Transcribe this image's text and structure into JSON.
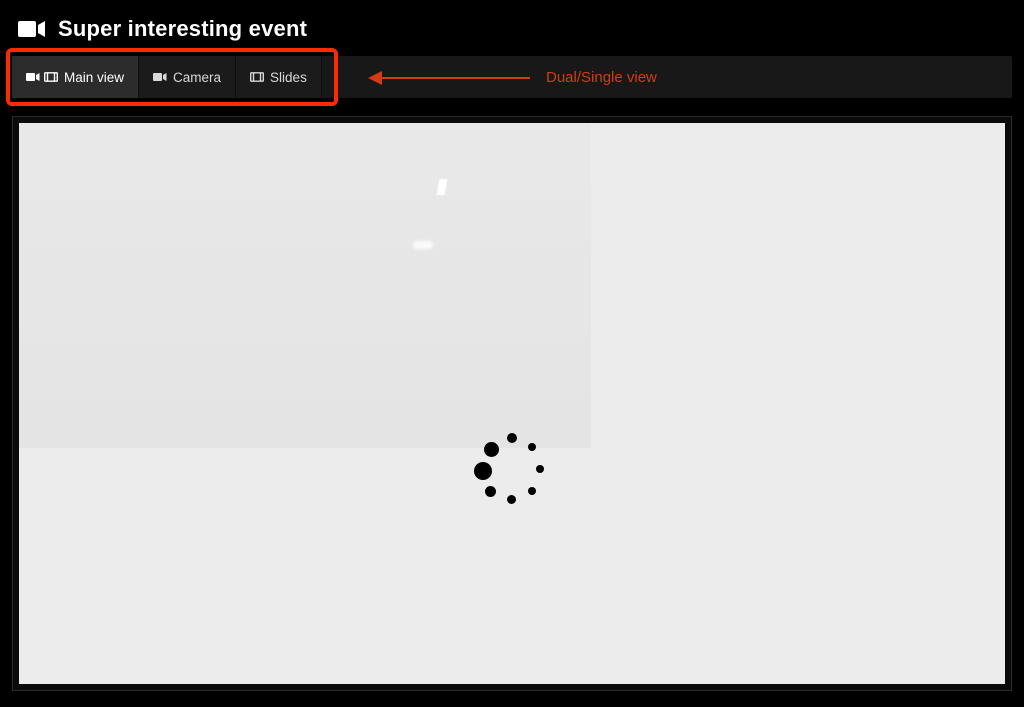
{
  "header": {
    "title": "Super interesting event"
  },
  "toolbar": {
    "tabs": [
      {
        "label": "Main view",
        "active": true
      },
      {
        "label": "Camera",
        "active": false
      },
      {
        "label": "Slides",
        "active": false
      }
    ]
  },
  "annotation": {
    "label": "Dual/Single view"
  },
  "icons": {
    "camera": "video-camera-icon",
    "slides": "slideshow-icon"
  },
  "player": {
    "state": "loading"
  },
  "colors": {
    "highlight": "#ff2a00",
    "annotation_text": "#d63a0e",
    "toolbar_bg": "#181818",
    "tab_active_bg": "#2c2c2c",
    "player_bg": "#ececec"
  }
}
